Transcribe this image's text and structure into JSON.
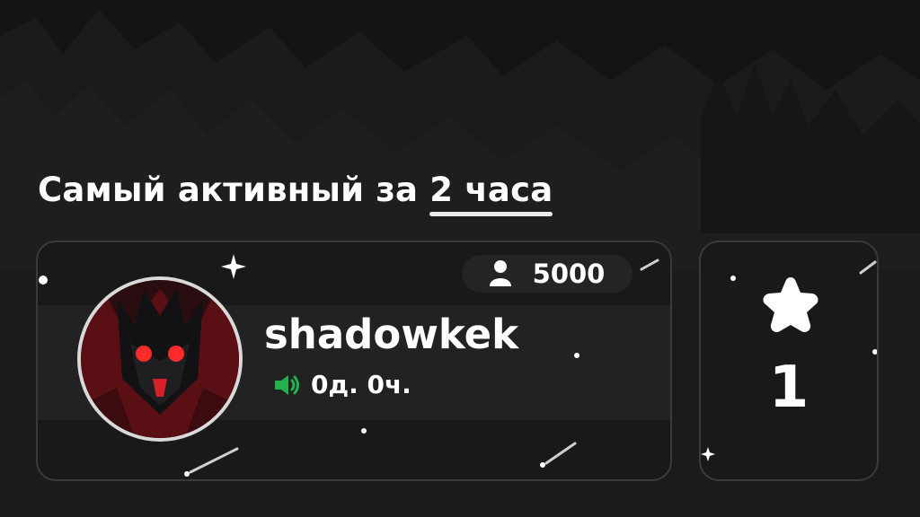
{
  "headline": {
    "text": "Самый активный за",
    "highlight": "2 часа"
  },
  "profile": {
    "username": "shadowkek",
    "voice_time": "0д. 0ч.",
    "members_count": "5000",
    "icons": {
      "members": "person-icon",
      "voice": "speaker-icon",
      "avatar": "shadow-fiend-avatar"
    }
  },
  "rank": {
    "position": "1",
    "icon": "star-icon"
  },
  "colors": {
    "background": "#1b1b1c",
    "card": "#191919",
    "card_border": "#3a3a3b",
    "voice_icon": "#22b14c",
    "avatar_eyes": "#ff2a2a"
  }
}
